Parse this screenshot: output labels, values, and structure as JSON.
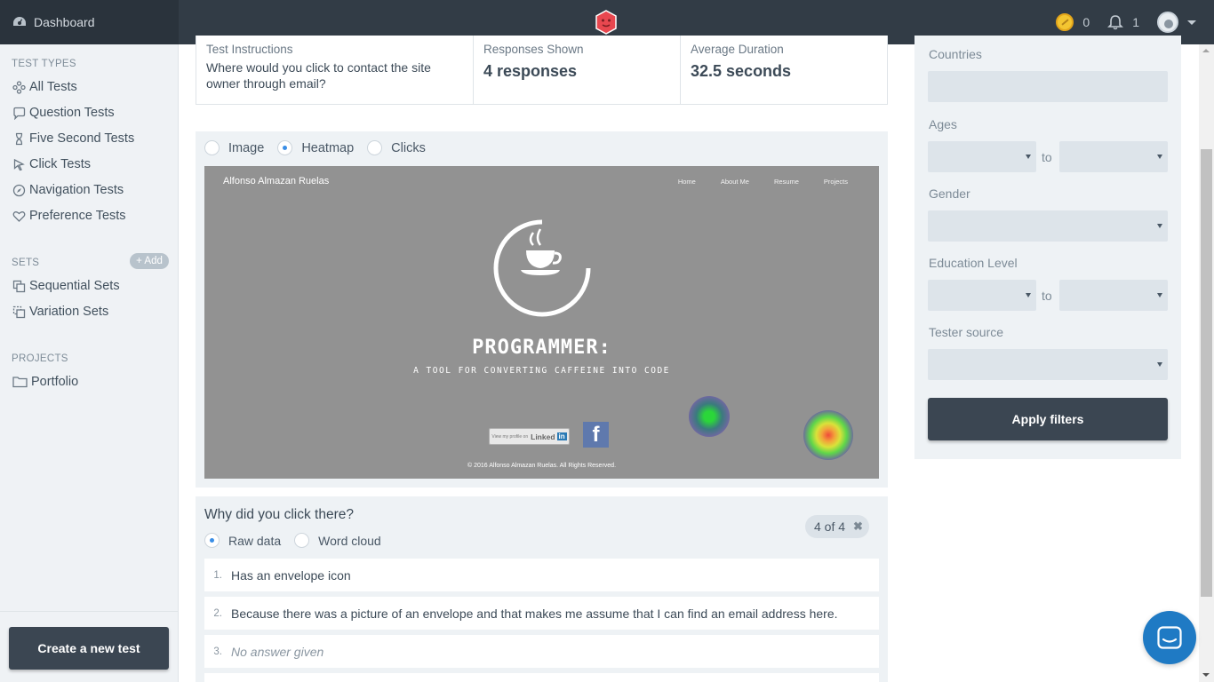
{
  "topbar": {
    "dashboard_label": "Dashboard",
    "coins_count": "0",
    "notifications_count": "1"
  },
  "sidebar": {
    "test_types_title": "TEST TYPES",
    "test_types": [
      {
        "label": "All Tests",
        "icon": "cluster-icon"
      },
      {
        "label": "Question Tests",
        "icon": "speech-bubble-icon"
      },
      {
        "label": "Five Second Tests",
        "icon": "hourglass-icon"
      },
      {
        "label": "Click Tests",
        "icon": "cursor-icon"
      },
      {
        "label": "Navigation Tests",
        "icon": "compass-icon"
      },
      {
        "label": "Preference Tests",
        "icon": "heart-icon"
      }
    ],
    "sets_title": "SETS",
    "add_label": "+ Add",
    "sets": [
      {
        "label": "Sequential Sets",
        "icon": "stacked-squares-icon"
      },
      {
        "label": "Variation Sets",
        "icon": "dashed-squares-icon"
      }
    ],
    "projects_title": "PROJECTS",
    "projects": [
      {
        "label": "Portfolio",
        "icon": "folder-icon"
      }
    ],
    "create_button": "Create a new test"
  },
  "summary": {
    "instructions_label": "Test Instructions",
    "instructions_text": "Where would you click to contact the site owner through email?",
    "responses_label": "Responses Shown",
    "responses_value": "4 responses",
    "duration_label": "Average Duration",
    "duration_value": "32.5 seconds"
  },
  "view_modes": {
    "image": "Image",
    "heatmap": "Heatmap",
    "clicks": "Clicks",
    "selected": "heatmap"
  },
  "screenshot": {
    "site_name": "Alfonso Almazan Ruelas",
    "nav": [
      "Home",
      "About Me",
      "Resume",
      "Projects"
    ],
    "headline": "PROGRAMMER:",
    "tagline": "A TOOL FOR CONVERTING CAFFEINE INTO CODE",
    "linkedin_label": "View my profile on",
    "linkedin_brand": "Linked",
    "linkedin_in": "in",
    "facebook_glyph": "f",
    "footer": "© 2016 Alfonso Almazan Ruelas. All Rights Reserved."
  },
  "question": {
    "title": "Why did you click there?",
    "raw_data": "Raw data",
    "word_cloud": "Word cloud",
    "selected": "raw_data",
    "badge": "4 of 4",
    "badge_close": "✖",
    "answers": [
      {
        "num": "1.",
        "text": "Has an envelope icon",
        "empty": false
      },
      {
        "num": "2.",
        "text": "Because there was a picture of an envelope and that makes me assume that I can find an email address here.",
        "empty": false
      },
      {
        "num": "3.",
        "text": "No answer given",
        "empty": true
      }
    ]
  },
  "filters": {
    "countries_label": "Countries",
    "ages_label": "Ages",
    "gender_label": "Gender",
    "education_label": "Education Level",
    "source_label": "Tester source",
    "to_label": "to",
    "apply_label": "Apply filters"
  },
  "colors": {
    "topbar": "#323c46",
    "sidebar": "#eff2f5",
    "button_dark": "#3b4652",
    "accent_blue": "#3a8ee6",
    "chat_blue": "#1f7ac4"
  }
}
